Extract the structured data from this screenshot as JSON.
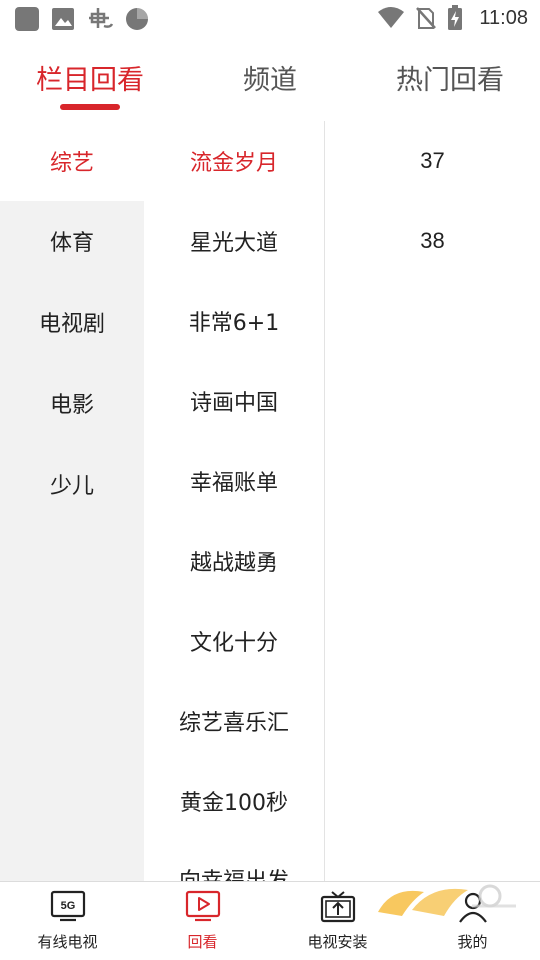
{
  "status_bar": {
    "time": "11:08",
    "icons": [
      "app-square-icon",
      "image-icon",
      "bug-icon",
      "circle-icon",
      "wifi-icon",
      "no-signal-icon",
      "battery-charging-icon"
    ]
  },
  "top_tabs": [
    {
      "label": "栏目回看",
      "active": true
    },
    {
      "label": "频道",
      "active": false
    },
    {
      "label": "热门回看",
      "active": false
    }
  ],
  "categories": [
    {
      "label": "综艺",
      "active": true
    },
    {
      "label": "体育",
      "active": false
    },
    {
      "label": "电视剧",
      "active": false
    },
    {
      "label": "电影",
      "active": false
    },
    {
      "label": "少儿",
      "active": false
    }
  ],
  "programs": [
    {
      "label": "流金岁月",
      "active": true
    },
    {
      "label": "星光大道",
      "active": false
    },
    {
      "label": "非常6+1",
      "active": false
    },
    {
      "label": "诗画中国",
      "active": false
    },
    {
      "label": "幸福账单",
      "active": false
    },
    {
      "label": "越战越勇",
      "active": false
    },
    {
      "label": "文化十分",
      "active": false
    },
    {
      "label": "综艺喜乐汇",
      "active": false
    },
    {
      "label": "黄金100秒",
      "active": false
    },
    {
      "label": "向幸福出发",
      "active": false
    }
  ],
  "episodes": [
    "37",
    "38"
  ],
  "bottom_nav": [
    {
      "label": "有线电视",
      "icon": "5g-tv-icon",
      "badge": "5G",
      "active": false
    },
    {
      "label": "回看",
      "icon": "play-tv-icon",
      "active": true
    },
    {
      "label": "电视安装",
      "icon": "tv-install-icon",
      "active": false
    },
    {
      "label": "我的",
      "icon": "user-icon",
      "active": false
    }
  ],
  "colors": {
    "accent": "#d8262b",
    "sidebar_bg": "#f2f2f2",
    "divider": "#e3e3e3"
  }
}
